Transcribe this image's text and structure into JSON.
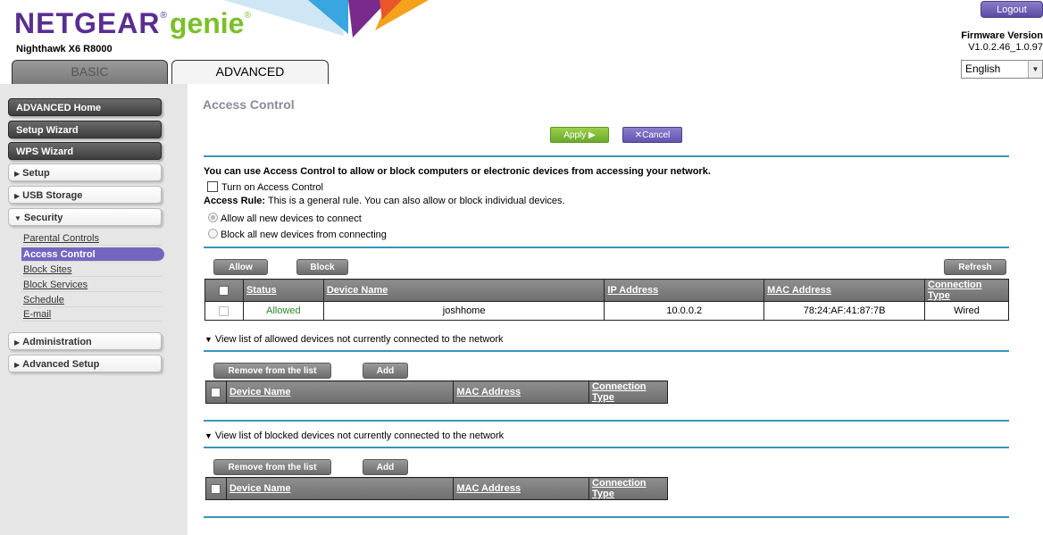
{
  "header": {
    "brand_netgear": "NETGEAR",
    "brand_reg": "®",
    "brand_genie": "genie",
    "brand_genie_reg": "®",
    "model": "Nighthawk X6 R8000",
    "tabs": [
      {
        "label": "BASIC",
        "active": false
      },
      {
        "label": "ADVANCED",
        "active": true
      }
    ],
    "logout_label": "Logout",
    "firmware_label": "Firmware Version",
    "firmware_value": "V1.0.2.46_1.0.97",
    "language": "English",
    "language_arrow": "▼"
  },
  "sidebar": {
    "top_buttons": [
      {
        "label": "ADVANCED Home"
      },
      {
        "label": "Setup Wizard"
      },
      {
        "label": "WPS Wizard"
      }
    ],
    "sections": [
      {
        "label": "Setup",
        "marker": "▶"
      },
      {
        "label": "USB Storage",
        "marker": "▶"
      },
      {
        "label": "Security",
        "marker": "▼"
      }
    ],
    "security_items": [
      {
        "label": "Parental Controls",
        "active": false
      },
      {
        "label": "Access Control",
        "active": true
      },
      {
        "label": "Block Sites",
        "active": false
      },
      {
        "label": "Block Services",
        "active": false
      },
      {
        "label": "Schedule",
        "active": false
      },
      {
        "label": "E-mail",
        "active": false
      }
    ],
    "bottom_sections": [
      {
        "label": "Administration",
        "marker": "▶"
      },
      {
        "label": "Advanced Setup",
        "marker": "▶"
      }
    ]
  },
  "main": {
    "title": "Access Control",
    "apply_label": "Apply ▶",
    "cancel_label": "✕Cancel",
    "intro": "You can use Access Control to allow or block computers or electronic devices from accessing your network.",
    "turn_on_label": "Turn on Access Control",
    "turn_on_checked": false,
    "rule_label": "Access Rule:",
    "rule_text": "This is a general rule. You can also allow or block individual devices.",
    "radio_allow": "Allow all new devices to connect",
    "radio_block": "Block all new devices from connecting",
    "allow_btn": "Allow",
    "block_btn": "Block",
    "refresh_btn": "Refresh",
    "devices_table": {
      "headers": [
        "Status",
        "Device Name",
        "IP Address",
        "MAC Address",
        "Connection Type"
      ],
      "rows": [
        {
          "status": "Allowed",
          "device_name": "joshhome",
          "ip": "10.0.0.2",
          "mac": "78:24:AF:41:87:7B",
          "conn": "Wired"
        }
      ]
    },
    "allowed_list": {
      "toggle_label": "View list of allowed devices not currently connected to the network",
      "remove_btn": "Remove from the list",
      "add_btn": "Add",
      "headers": [
        "Device Name",
        "MAC Address",
        "Connection Type"
      ]
    },
    "blocked_list": {
      "toggle_label": "View list of blocked devices not currently connected to the network",
      "remove_btn": "Remove from the list",
      "add_btn": "Add",
      "headers": [
        "Device Name",
        "MAC Address",
        "Connection Type"
      ]
    }
  },
  "colors": {
    "brand_purple": "#5a2d91",
    "brand_green": "#7bbf2a",
    "accent_blue": "#3b95b8",
    "active_nav": "#7466c0"
  }
}
